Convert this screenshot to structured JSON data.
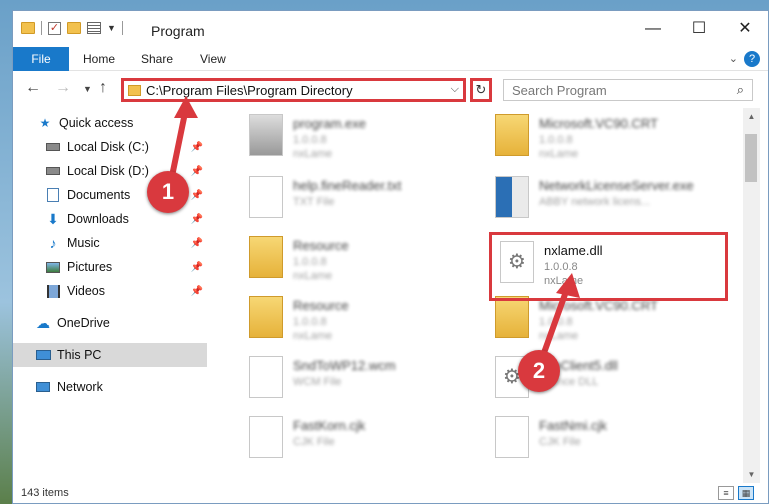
{
  "window": {
    "title": "Program"
  },
  "titlebar": {
    "minimize": "—",
    "maximize": "☐",
    "close": "✕"
  },
  "ribbon": {
    "tabs": [
      "File",
      "Home",
      "Share",
      "View"
    ],
    "help": "?"
  },
  "address": {
    "path": "C:\\Program Files\\Program Directory"
  },
  "search": {
    "placeholder": "Search Program"
  },
  "nav": {
    "items": [
      {
        "label": "Quick access",
        "icon": "star-icon"
      },
      {
        "label": "Local Disk (C:)",
        "icon": "drive-icon",
        "pinned": true
      },
      {
        "label": "Local Disk (D:)",
        "icon": "drive-icon",
        "pinned": true
      },
      {
        "label": "Documents",
        "icon": "documents-icon",
        "pinned": true
      },
      {
        "label": "Downloads",
        "icon": "download-icon",
        "pinned": true
      },
      {
        "label": "Music",
        "icon": "music-icon",
        "pinned": true
      },
      {
        "label": "Pictures",
        "icon": "pictures-icon",
        "pinned": true
      },
      {
        "label": "Videos",
        "icon": "videos-icon",
        "pinned": true
      },
      {
        "label": "OneDrive",
        "icon": "cloud-icon"
      },
      {
        "label": "This PC",
        "icon": "computer-icon",
        "selected": true
      },
      {
        "label": "Network",
        "icon": "network-icon"
      }
    ]
  },
  "files": [
    {
      "name": "program.exe",
      "l2": "1.0.0.8",
      "l3": "nxLame",
      "type": "exe"
    },
    {
      "name": "Microsoft.VC90.CRT",
      "l2": "1.0.0.8",
      "l3": "nxLame",
      "type": "folder"
    },
    {
      "name": "help.fineReader.txt",
      "l2": "TXT File",
      "l3": "",
      "type": "doc"
    },
    {
      "name": "NetworkLicenseServer.exe",
      "l2": "ABBY network licens...",
      "l3": "",
      "type": "app"
    },
    {
      "name": "Resource",
      "l2": "1.0.0.8",
      "l3": "nxLame",
      "type": "folder"
    },
    {
      "name": "nxlame.dll",
      "l2": "1.0.0.8",
      "l3": "nxLame",
      "type": "dll"
    },
    {
      "name": "Resource",
      "l2": "1.0.0.8",
      "l3": "nxLame",
      "type": "folder"
    },
    {
      "name": "Microsoft.VC90.CRT",
      "l2": "1.0.0.8",
      "l3": "nxLame",
      "type": "folder"
    },
    {
      "name": "SndToWP12.wcm",
      "l2": "WCM File",
      "l3": "",
      "type": "doc"
    },
    {
      "name": "...teClient5.dll",
      "l2": "...tence DLL",
      "l3": "",
      "type": "dll"
    },
    {
      "name": "FastKorn.cjk",
      "l2": "CJK File",
      "l3": "",
      "type": "doc"
    },
    {
      "name": "FastNmi.cjk",
      "l2": "CJK File",
      "l3": "",
      "type": "doc"
    }
  ],
  "status": {
    "count": "143 items"
  },
  "annotations": {
    "step1": "1",
    "step2": "2"
  },
  "colors": {
    "accent": "#1979ca",
    "highlight": "#d9393e"
  }
}
